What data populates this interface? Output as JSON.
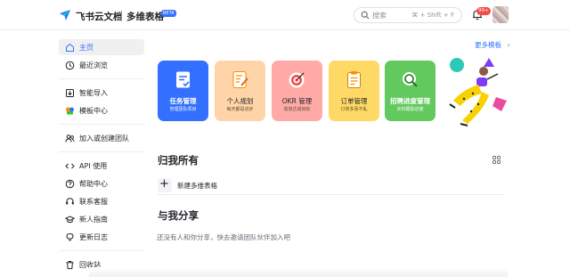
{
  "header": {
    "app_name": "飞书云文档",
    "product_name": "多维表格",
    "beta_label": "BETA",
    "search_placeholder": "搜索",
    "search_shortcut": "⌘ + Shift + F",
    "notification_count": "99+",
    "icons": [
      "feishu-logo-icon",
      "search-icon",
      "bell-icon"
    ]
  },
  "sidebar": {
    "items": [
      {
        "label": "主页",
        "icon": "home-icon",
        "active": true
      },
      {
        "label": "最近浏览",
        "icon": "clock-icon"
      },
      {
        "label": "智能导入",
        "icon": "import-icon"
      },
      {
        "label": "模板中心",
        "icon": "template-icon"
      },
      {
        "label": "加入或创建团队",
        "icon": "team-icon"
      },
      {
        "label": "API 使用",
        "icon": "code-icon"
      },
      {
        "label": "帮助中心",
        "icon": "help-icon"
      },
      {
        "label": "联系客服",
        "icon": "customer-service-icon"
      },
      {
        "label": "新人指南",
        "icon": "graduation-icon"
      },
      {
        "label": "更新日志",
        "icon": "bulb-icon"
      },
      {
        "label": "回收站",
        "icon": "trash-icon"
      }
    ]
  },
  "main": {
    "more_templates": "更多模板",
    "templates": [
      {
        "title": "任务管理",
        "subtitle": "管理团队项目",
        "color": "#3370ff",
        "icon": "task-icon"
      },
      {
        "title": "个人规划",
        "subtitle": "每天都是进步",
        "color": "#ffd4a8",
        "icon": "plan-icon"
      },
      {
        "title": "OKR 管理",
        "subtitle": "高效达成目标",
        "color": "#ffaaa6",
        "icon": "target-icon"
      },
      {
        "title": "订单管理",
        "subtitle": "订单多而不乱",
        "color": "#ffd965",
        "icon": "order-icon"
      },
      {
        "title": "招聘进度管理",
        "subtitle": "实时跟踪进度",
        "color": "#62c95f",
        "icon": "recruit-icon"
      }
    ],
    "my_section_title": "归我所有",
    "new_table_label": "新建多维表格",
    "shared_section_title": "与我分享",
    "shared_empty_text": "还没有人和你分享，快去邀请团队伙伴加入吧"
  }
}
